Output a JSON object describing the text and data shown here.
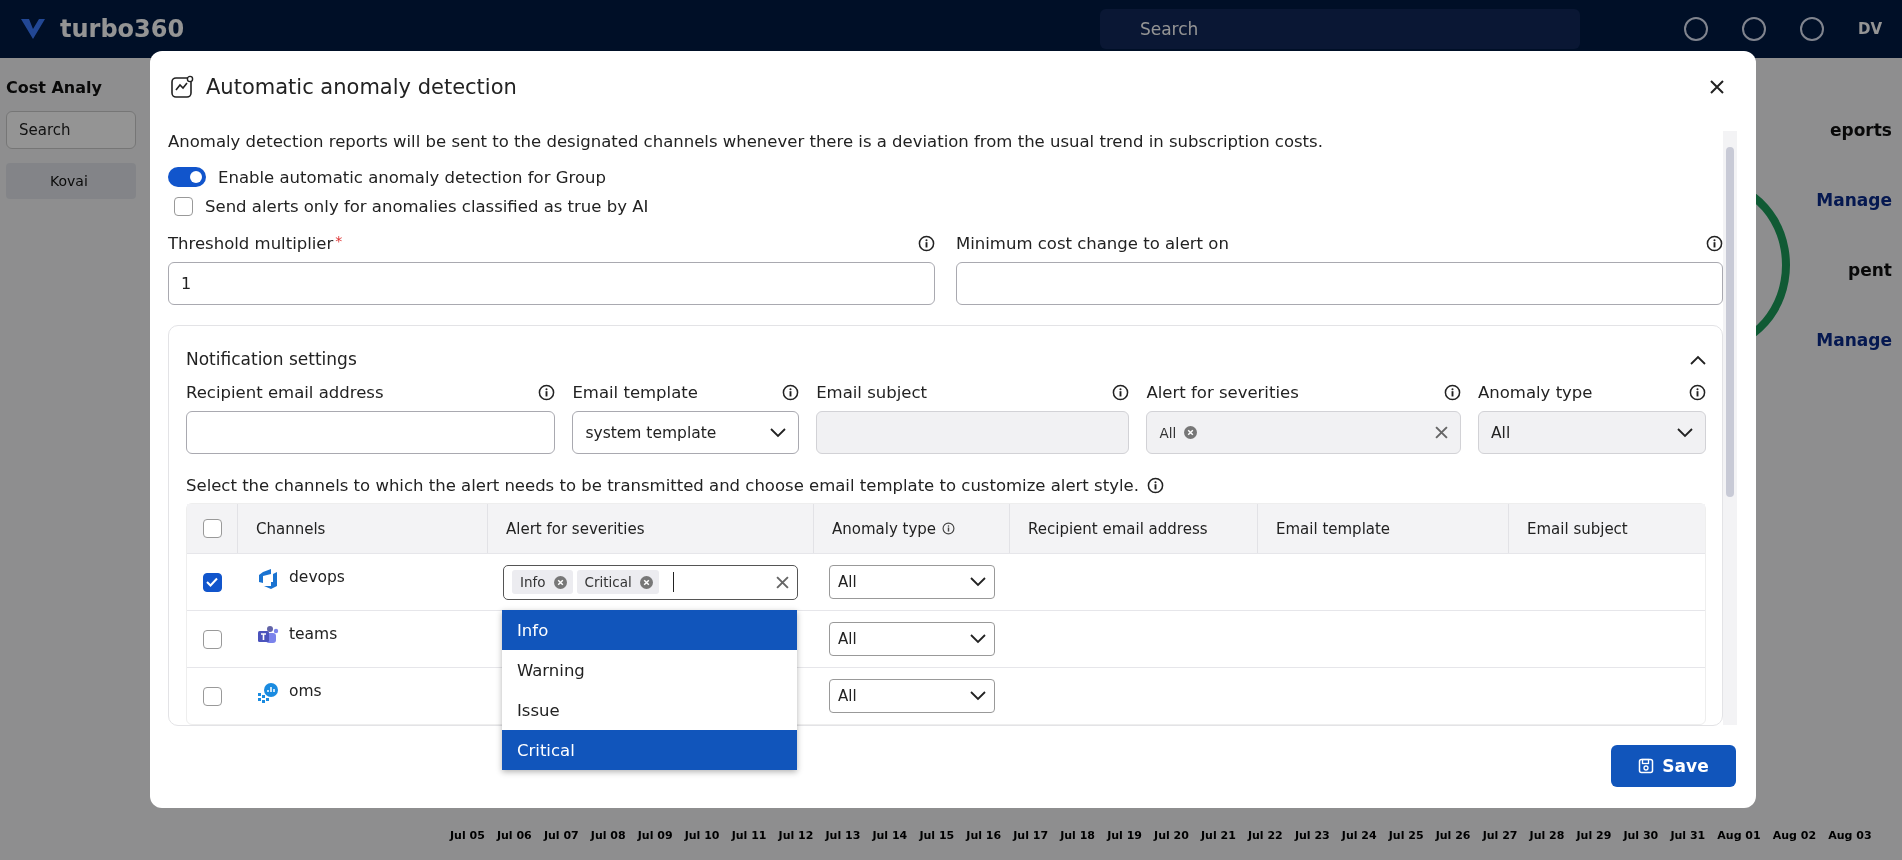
{
  "background": {
    "logo_text": "turbo360",
    "search_placeholder": "Search",
    "user_initials": "DV",
    "page_title": "Cost Analy",
    "sidebar_search_placeholder": "Search",
    "tree_item": "Kovai",
    "tab_label": "eports",
    "manage_links": [
      "Manage",
      "Manage"
    ],
    "legend_text": "pent",
    "date_labels": [
      "Jul 05",
      "Jul 06",
      "Jul 07",
      "Jul 08",
      "Jul 09",
      "Jul 10",
      "Jul 11",
      "Jul 12",
      "Jul 13",
      "Jul 14",
      "Jul 15",
      "Jul 16",
      "Jul 17",
      "Jul 18",
      "Jul 19",
      "Jul 20",
      "Jul 21",
      "Jul 22",
      "Jul 23",
      "Jul 24",
      "Jul 25",
      "Jul 26",
      "Jul 27",
      "Jul 28",
      "Jul 29",
      "Jul 30",
      "Jul 31",
      "Aug 01",
      "Aug 02",
      "Aug 03"
    ]
  },
  "dialog": {
    "title": "Automatic anomaly detection",
    "description": "Anomaly detection reports will be sent to the designated channels whenever there is a deviation from the usual trend in subscription costs.",
    "toggle": {
      "label": "Enable automatic anomaly detection for Group",
      "on": true
    },
    "ai_checkbox": {
      "label": "Send alerts only for anomalies classified as true by AI",
      "checked": false
    },
    "threshold": {
      "label": "Threshold multiplier",
      "required_mark": "*",
      "value": "1"
    },
    "min_cost": {
      "label": "Minimum cost change to alert on"
    },
    "notification_settings": {
      "title": "Notification settings",
      "expanded": true,
      "fields": [
        {
          "label": "Recipient email address",
          "kind": "text",
          "disabled": false
        },
        {
          "label": "Email template",
          "kind": "select",
          "value": "system template",
          "disabled": false
        },
        {
          "label": "Email subject",
          "kind": "text",
          "disabled": true
        },
        {
          "label": "Alert for severities",
          "kind": "tags",
          "tags": [
            "All"
          ],
          "disabled": true
        },
        {
          "label": "Anomaly type",
          "kind": "select",
          "value": "All",
          "disabled": true
        }
      ],
      "helper_text": "Select the channels to which the alert needs to be transmitted and choose email template to customize alert style.",
      "table": {
        "header_checked": false,
        "columns": [
          {
            "label": "Channels",
            "info": false
          },
          {
            "label": "Alert for severities",
            "info": false
          },
          {
            "label": "Anomaly type",
            "info": true
          },
          {
            "label": "Recipient email address",
            "info": false
          },
          {
            "label": "Email template",
            "info": false
          },
          {
            "label": "Email subject",
            "info": false
          }
        ],
        "rows": [
          {
            "channel": "devops",
            "kind": "devops",
            "checked": true,
            "severity_tags": [
              "Info",
              "Critical"
            ],
            "anomaly_type": "All"
          },
          {
            "channel": "teams",
            "kind": "teams",
            "checked": false,
            "anomaly_type": "All"
          },
          {
            "channel": "oms",
            "kind": "oms",
            "checked": false,
            "anomaly_type": "All"
          }
        ]
      }
    },
    "severity_dropdown": {
      "options": [
        {
          "label": "Info",
          "selected": true
        },
        {
          "label": "Warning",
          "selected": false
        },
        {
          "label": "Issue",
          "selected": false
        },
        {
          "label": "Critical",
          "selected": true
        }
      ]
    },
    "save_button": "Save"
  }
}
